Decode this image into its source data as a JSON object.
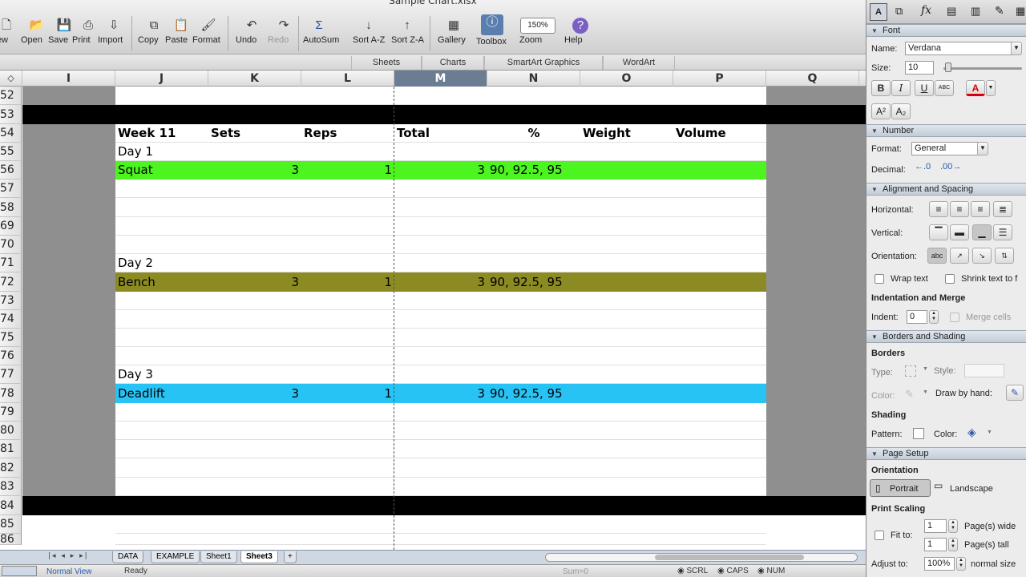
{
  "window": {
    "title": "Sample Chart.xlsx"
  },
  "toolbar": {
    "items": [
      {
        "label": "New",
        "icon": "new-doc-icon"
      },
      {
        "label": "Open",
        "icon": "open-folder-icon"
      },
      {
        "label": "Save",
        "icon": "save-disk-icon"
      },
      {
        "label": "Print",
        "icon": "printer-icon"
      },
      {
        "label": "Import",
        "icon": "import-icon"
      },
      {
        "label": "Copy",
        "icon": "copy-icon"
      },
      {
        "label": "Paste",
        "icon": "paste-icon"
      },
      {
        "label": "Format",
        "icon": "format-brush-icon"
      },
      {
        "label": "Undo",
        "icon": "undo-icon"
      },
      {
        "label": "Redo",
        "icon": "redo-icon"
      },
      {
        "label": "AutoSum",
        "icon": "sigma-icon"
      },
      {
        "label": "Sort A-Z",
        "icon": "sort-az-icon"
      },
      {
        "label": "Sort Z-A",
        "icon": "sort-za-icon"
      },
      {
        "label": "Gallery",
        "icon": "gallery-icon"
      },
      {
        "label": "Toolbox",
        "icon": "toolbox-icon"
      },
      {
        "label": "Zoom",
        "icon": "zoom-icon",
        "value": "150%"
      },
      {
        "label": "Help",
        "icon": "help-icon"
      }
    ]
  },
  "ribbon": {
    "tabs": [
      "Sheets",
      "Charts",
      "SmartArt Graphics",
      "WordArt"
    ]
  },
  "grid": {
    "columns": [
      "I",
      "J",
      "K",
      "L",
      "M",
      "N",
      "O",
      "P",
      "Q"
    ],
    "selected_column": "M",
    "rows": [
      "52",
      "53",
      "54",
      "55",
      "56",
      "57",
      "58",
      "69",
      "70",
      "71",
      "72",
      "73",
      "74",
      "75",
      "76",
      "77",
      "78",
      "79",
      "80",
      "81",
      "82",
      "83",
      "84",
      "85",
      "86"
    ],
    "header_row": {
      "J": "Week 11",
      "K": "Sets",
      "L": "Reps",
      "M": "Total",
      "N": "%",
      "O": "Weight",
      "P": "Volume"
    },
    "day1_label": "Day 1",
    "day2_label": "Day 2",
    "day3_label": "Day 3",
    "exercises": [
      {
        "name": "Squat",
        "sets": "3",
        "reps": "1",
        "total": "3",
        "pct": "90, 92.5, 95",
        "color": "#4cf51f"
      },
      {
        "name": "Bench",
        "sets": "3",
        "reps": "1",
        "total": "3",
        "pct": "90, 92.5, 95",
        "color": "#8c8a22"
      },
      {
        "name": "Deadlift",
        "sets": "3",
        "reps": "1",
        "total": "3",
        "pct": "90, 92.5, 95",
        "color": "#28c3f5"
      }
    ]
  },
  "sheet_tabs": {
    "tabs": [
      "DATA",
      "EXAMPLE",
      "Sheet1",
      "Sheet3"
    ],
    "active": "Sheet3"
  },
  "status": {
    "view": "Normal View",
    "state": "Ready",
    "sum": "Sum=0",
    "scrl": "SCRL",
    "caps": "CAPS",
    "num": "NUM"
  },
  "toolbox": {
    "font": {
      "header": "Font",
      "name_label": "Name:",
      "name": "Verdana",
      "size_label": "Size:",
      "size": "10"
    },
    "number": {
      "header": "Number",
      "format_label": "Format:",
      "format": "General",
      "decimal_label": "Decimal:"
    },
    "alignment": {
      "header": "Alignment and Spacing",
      "horizontal_label": "Horizontal:",
      "vertical_label": "Vertical:",
      "orientation_label": "Orientation:",
      "wrap_label": "Wrap text",
      "shrink_label": "Shrink text to f"
    },
    "indent": {
      "header": "Indentation and Merge",
      "indent_label": "Indent:",
      "indent": "0",
      "merge_label": "Merge cells"
    },
    "borders": {
      "header": "Borders and Shading",
      "borders_title": "Borders",
      "type_label": "Type:",
      "style_label": "Style:",
      "color_label": "Color:",
      "draw_label": "Draw by hand:",
      "shading_title": "Shading",
      "pattern_label": "Pattern:",
      "shading_color_label": "Color:"
    },
    "page_setup": {
      "header": "Page Setup",
      "orientation_title": "Orientation",
      "portrait_label": "Portrait",
      "landscape_label": "Landscape",
      "scaling_title": "Print Scaling",
      "fit_label": "Fit to:",
      "wide_value": "1",
      "wide_label": "Page(s) wide",
      "tall_value": "1",
      "tall_label": "Page(s) tall",
      "adjust_label": "Adjust to:",
      "adjust_value": "100%",
      "normal_label": "normal size"
    }
  },
  "colors": {
    "black_band": "#000000",
    "gray_margin": "#8f8f8f",
    "selected_header": "#6b7d93"
  }
}
